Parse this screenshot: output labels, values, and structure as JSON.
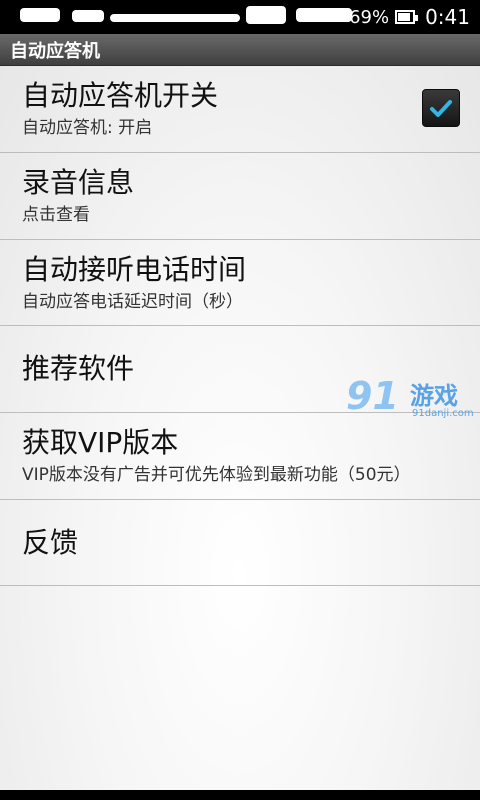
{
  "status_bar": {
    "battery_percent": "69%",
    "time": "0:41",
    "icons": [
      "battery-icon"
    ]
  },
  "app": {
    "title": "自动应答机"
  },
  "preferences": [
    {
      "title": "自动应答机开关",
      "summary": "自动应答机: 开启",
      "checked": true
    },
    {
      "title": "录音信息",
      "summary": "点击查看"
    },
    {
      "title": "自动接听电话时间",
      "summary": "自动应答电话延迟时间（秒）"
    },
    {
      "title": "推荐软件",
      "summary": ""
    },
    {
      "title": "获取VIP版本",
      "summary": "VIP版本没有广告并可优先体验到最新功能（50元）"
    },
    {
      "title": "反馈",
      "summary": ""
    }
  ],
  "watermark": {
    "logo": "91",
    "text": "游戏",
    "url": "91danji.com"
  },
  "colors": {
    "title_bar": "#555555",
    "checkmark": "#33b5e5",
    "background": "#f2f2f2",
    "divider": "#bdbdbd"
  }
}
